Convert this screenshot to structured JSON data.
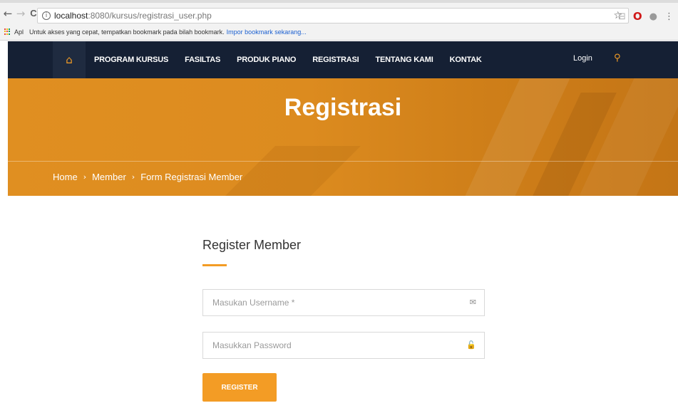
{
  "browser": {
    "back_icon": "←",
    "forward_icon": "→",
    "reload_icon": "C",
    "info_icon": "i",
    "url_host": "localhost",
    "url_path": ":8080/kursus/registrasi_user.php",
    "star_icon": "☆",
    "bookmarks_apps": "Apl",
    "bookmarks_text": "Untuk akses yang cepat, tempatkan bookmark pada bilah bookmark.",
    "bookmarks_import": "Impor bookmark sekarang..."
  },
  "nav": {
    "home_icon": "⌂",
    "items": [
      "PROGRAM KURSUS",
      "FASILTAS",
      "PRODUK PIANO",
      "REGISTRASI",
      "TENTANG KAMI",
      "KONTAK"
    ],
    "login": "Login",
    "search_icon": "⚲"
  },
  "banner": {
    "title": "Registrasi",
    "breadcrumb": [
      "Home",
      "Member",
      "Form Registrasi Member"
    ],
    "separator": "›"
  },
  "form": {
    "title": "Register Member",
    "username_placeholder": "Masukan Username *",
    "password_placeholder": "Masukkan Password",
    "mail_icon": "✉",
    "lock_icon": "🔓",
    "submit_label": "REGISTER"
  },
  "colors": {
    "accent": "#f39c25",
    "navbar": "#152034",
    "banner": "#dc8b1f"
  }
}
